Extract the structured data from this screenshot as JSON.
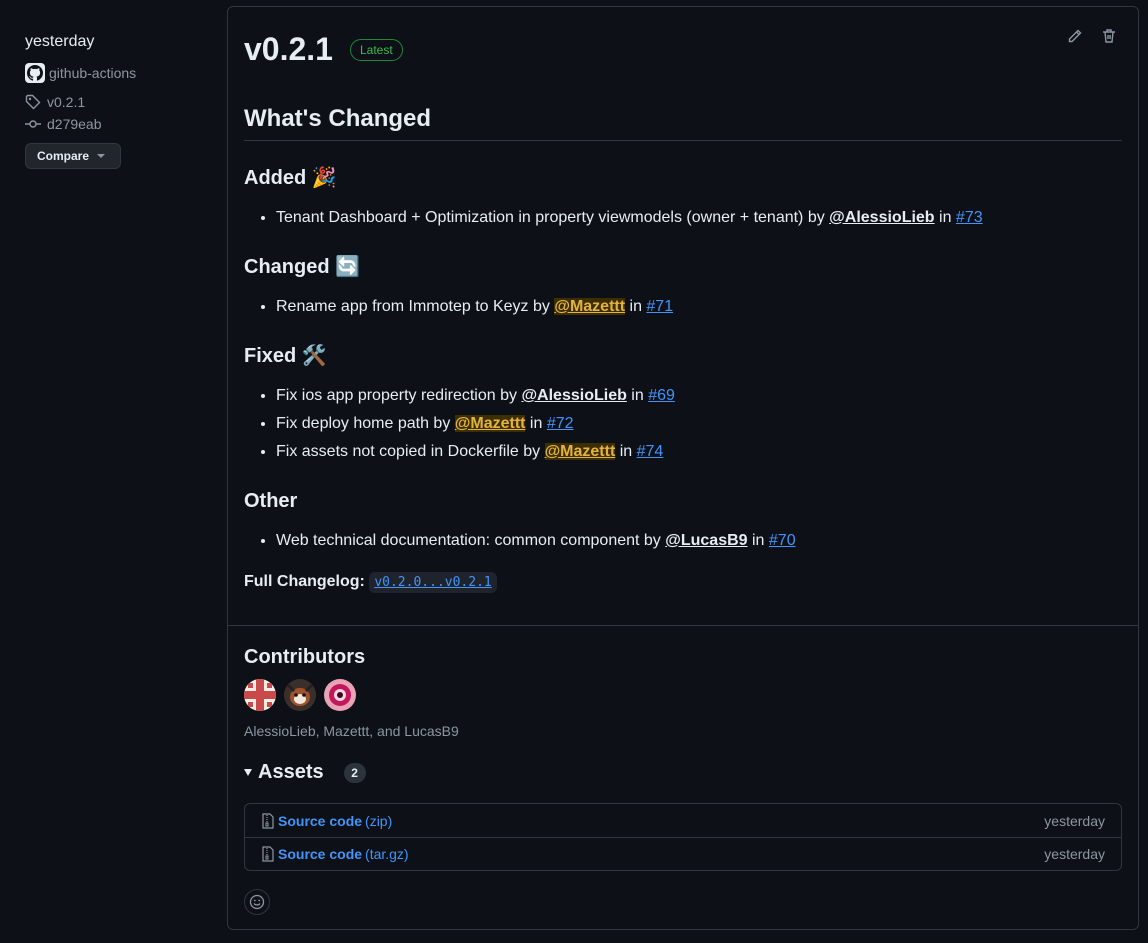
{
  "sidebar": {
    "date": "yesterday",
    "author": "github-actions",
    "tag": "v0.2.1",
    "commit": "d279eab",
    "compare_label": "Compare"
  },
  "release": {
    "title": "v0.2.1",
    "badge": "Latest",
    "heading": "What's Changed",
    "sections": [
      {
        "title": "Added",
        "emoji": "🎉",
        "items": [
          {
            "text": "Tenant Dashboard + Optimization in property viewmodels (owner + tenant) by ",
            "user": "@AlessioLieb",
            "sep": " in ",
            "pr": "#73"
          }
        ]
      },
      {
        "title": "Changed",
        "emoji": "🔄",
        "items": [
          {
            "text": "Rename app from Immotep to Keyz by ",
            "user": "@Mazettt",
            "sep": " in ",
            "pr": "#71"
          }
        ]
      },
      {
        "title": "Fixed",
        "emoji": "🛠️",
        "items": [
          {
            "text": "Fix ios app property redirection by ",
            "user": "@AlessioLieb",
            "sep": " in ",
            "pr": "#69"
          },
          {
            "text": "Fix deploy home path by ",
            "user": "@Mazettt",
            "sep": " in ",
            "pr": "#72"
          },
          {
            "text": "Fix assets not copied in Dockerfile by ",
            "user": "@Mazettt",
            "sep": " in ",
            "pr": "#74"
          }
        ]
      },
      {
        "title": "Other",
        "emoji": "",
        "items": [
          {
            "text": "Web technical documentation: common component by ",
            "user": "@LucasB9",
            "sep": " in ",
            "pr": "#70"
          }
        ]
      }
    ],
    "full_changelog_label": "Full Changelog:",
    "full_changelog_range": "v0.2.0...v0.2.1"
  },
  "contributors": {
    "title": "Contributors",
    "names": "AlessioLieb, Mazettt, and LucasB9"
  },
  "assets": {
    "title": "Assets",
    "count": "2",
    "items": [
      {
        "name": "Source code",
        "format": "(zip)",
        "date": "yesterday"
      },
      {
        "name": "Source code",
        "format": "(tar.gz)",
        "date": "yesterday"
      }
    ]
  },
  "colors": {
    "background": "#0d1117",
    "border": "#30363d",
    "link": "#4493f8",
    "latest_green": "#3fb950",
    "highlight_mention": "#e3b341"
  },
  "icons": [
    "github-icon",
    "tag-icon",
    "commit-icon",
    "edit-icon",
    "trash-icon",
    "file-zip-icon",
    "smiley-icon"
  ]
}
